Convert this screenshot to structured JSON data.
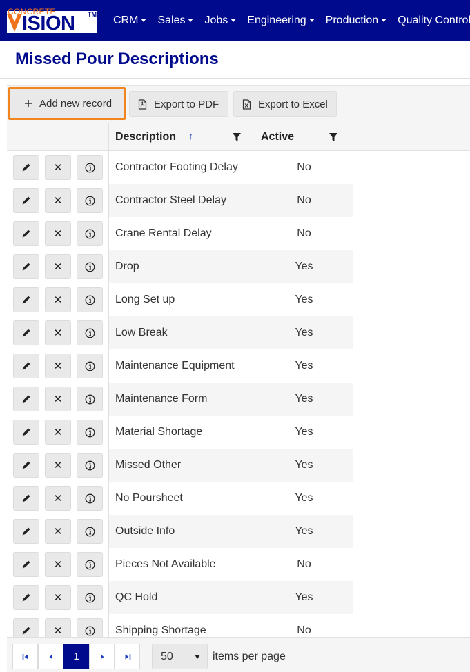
{
  "brand": {
    "logo_top": "CONCRETE",
    "logo_main": "ISION",
    "logo_tm": "TM"
  },
  "nav": {
    "items": [
      {
        "label": "CRM"
      },
      {
        "label": "Sales"
      },
      {
        "label": "Jobs"
      },
      {
        "label": "Engineering"
      },
      {
        "label": "Production"
      },
      {
        "label": "Quality Control"
      }
    ]
  },
  "page": {
    "title": "Missed Pour Descriptions"
  },
  "toolbar": {
    "add_label": "Add new record",
    "pdf_label": "Export to PDF",
    "excel_label": "Export to Excel"
  },
  "grid": {
    "columns": {
      "description": "Description",
      "active": "Active"
    },
    "sort_direction": "ascending",
    "rows": [
      {
        "description": "Contractor Footing Delay",
        "active": "No"
      },
      {
        "description": "Contractor Steel Delay",
        "active": "No"
      },
      {
        "description": "Crane Rental Delay",
        "active": "No"
      },
      {
        "description": "Drop",
        "active": "Yes"
      },
      {
        "description": "Long Set up",
        "active": "Yes"
      },
      {
        "description": "Low Break",
        "active": "Yes"
      },
      {
        "description": "Maintenance Equipment",
        "active": "Yes"
      },
      {
        "description": "Maintenance Form",
        "active": "Yes"
      },
      {
        "description": "Material Shortage",
        "active": "Yes"
      },
      {
        "description": "Missed Other",
        "active": "Yes"
      },
      {
        "description": "No Poursheet",
        "active": "Yes"
      },
      {
        "description": "Outside Info",
        "active": "Yes"
      },
      {
        "description": "Pieces Not Available",
        "active": "No"
      },
      {
        "description": "QC Hold",
        "active": "Yes"
      },
      {
        "description": "Shipping Shortage",
        "active": "No"
      }
    ]
  },
  "pager": {
    "current_page": "1",
    "page_size": "50",
    "items_per_page_label": "items per page"
  },
  "colors": {
    "navbar": "#000a8c",
    "title": "#000a8c",
    "accent_orange": "#f0851f",
    "pager_current": "#000a8c"
  }
}
